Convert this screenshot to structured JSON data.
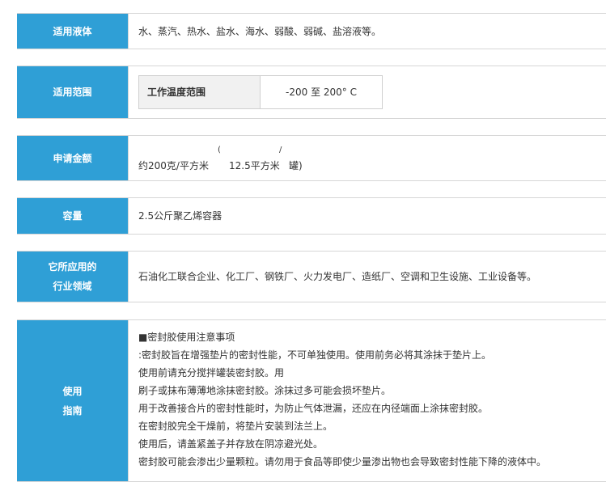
{
  "rows": {
    "liquids": {
      "label": "适用液体",
      "text": "水、蒸汽、热水、盐水、海水、弱酸、弱碱、盐溶液等。"
    },
    "range": {
      "label": "适用范围",
      "head": "工作温度范围",
      "value": "-200 至 200° C"
    },
    "amount": {
      "label": "申请金额",
      "paren": "(",
      "slash": "/",
      "main": "约200克/平方米",
      "mid": "12.5平方米",
      "end": "罐)"
    },
    "capacity": {
      "label": "容量",
      "text": "2.5公斤聚乙烯容器"
    },
    "industry": {
      "label_line1": "它所应用的",
      "label_line2": "行业领域",
      "text": "石油化工联合企业、化工厂、钢铁厂、火力发电厂、造纸厂、空调和卫生设施、工业设备等。"
    },
    "guide": {
      "label_line1": "使用",
      "label_line2": "指南",
      "lines": [
        "■密封胶使用注意事项",
        ":密封胶旨在增强垫片的密封性能，不可单独使用。使用前务必将其涂抹于垫片上。",
        "使用前请充分搅拌罐装密封胶。用",
        "刷子或抹布薄薄地涂抹密封胶。涂抹过多可能会损坏垫片。",
        "用于改善接合片的密封性能时，为防止气体泄漏，还应在内径端面上涂抹密封胶。",
        "在密封胶完全干燥前，将垫片安装到法兰上。",
        "使用后，请盖紧盖子并存放在阴凉避光处。",
        "密封胶可能会渗出少量颗粒。请勿用于食品等即使少量渗出物也会导致密封性能下降的液体中。"
      ]
    }
  },
  "colors": {
    "label_bg": "#2f9fd6",
    "label_text": "#ffffff",
    "border": "#d6d6d6"
  }
}
